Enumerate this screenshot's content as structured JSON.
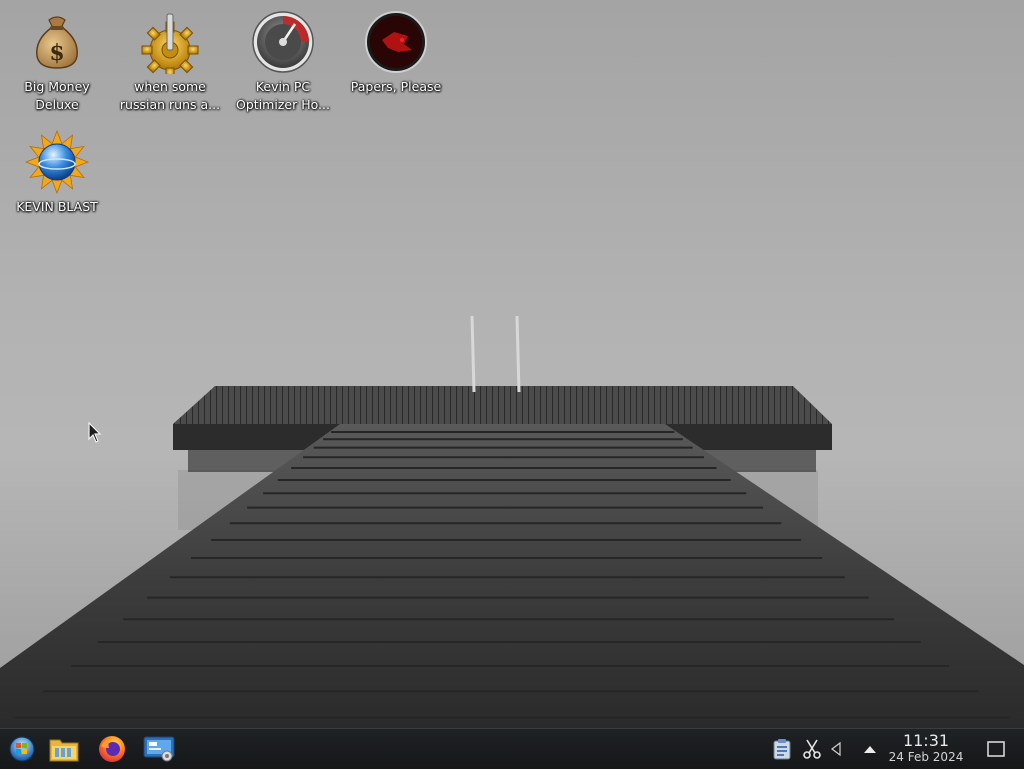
{
  "desktop": {
    "icons": [
      {
        "label": "Big Money\nDeluxe",
        "icon": "money-bag-icon"
      },
      {
        "label": "when some\nrussian runs a...",
        "icon": "gear-icon"
      },
      {
        "label": "Kevin PC\nOptimizer Ho...",
        "icon": "speedometer-icon"
      },
      {
        "label": "Papers, Please",
        "icon": "papers-please-icon"
      },
      {
        "label": "KEVIN BLAST",
        "icon": "sun-globe-icon"
      }
    ]
  },
  "taskbar": {
    "launcher_icon": "application-launcher-icon",
    "pinned": [
      {
        "icon": "file-manager-icon"
      },
      {
        "icon": "firefox-icon"
      },
      {
        "icon": "system-settings-icon"
      }
    ],
    "tray": [
      {
        "icon": "clipboard-icon"
      },
      {
        "icon": "screenshot-scissors-icon"
      },
      {
        "icon": "volume-icon"
      },
      {
        "icon": "show-hidden-icons-arrow"
      }
    ],
    "clock": {
      "time": "11:31",
      "date": "24 Feb 2024"
    },
    "show_desktop_icon": "show-desktop-icon"
  }
}
